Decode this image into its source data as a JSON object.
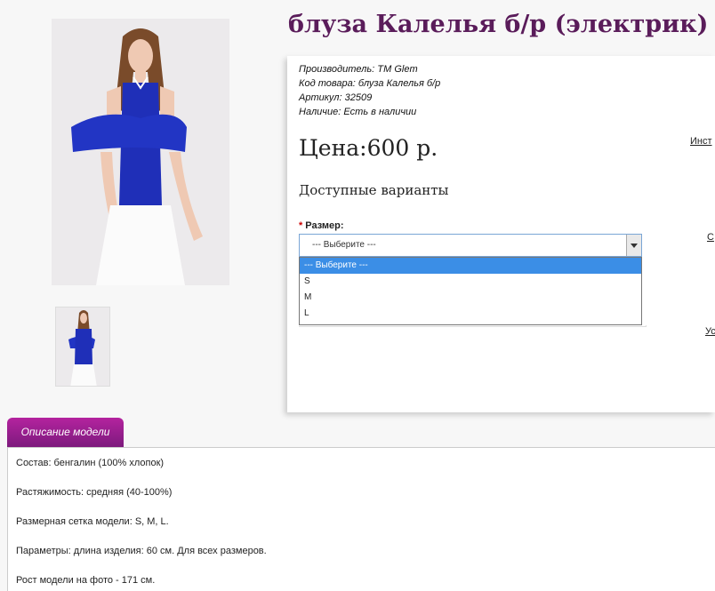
{
  "product": {
    "title": "блуза Калелья б/р (электрик)",
    "manufacturer_label": "Производитель:",
    "manufacturer": "ТМ Glem",
    "code_label": "Код товара:",
    "code": "блуза Калелья б/р",
    "sku_label": "Артикул:",
    "sku": "32509",
    "availability_label": "Наличие:",
    "availability": "Есть в наличии",
    "price": "Цена:600 р."
  },
  "options": {
    "heading": "Доступные варианты",
    "required_mark": "*",
    "size_label": "Размер:",
    "selected": "--- Выберите ---",
    "list": [
      "--- Выберите ---",
      "S",
      "M",
      "L"
    ]
  },
  "side_links": [
    "Инст",
    "С",
    "Ус"
  ],
  "tabs": {
    "description": "Описание модели"
  },
  "description": [
    {
      "label": "Состав:",
      "text": " бенгалин (100% хлопок)"
    },
    {
      "label": "Растяжимость:",
      "text": " средняя (40-100%)"
    },
    {
      "label": "Размерная сетка модели:",
      "text": " S, M, L."
    },
    {
      "label": "Параметры:",
      "text": " длина изделия: 60 см. Для всех размеров."
    },
    {
      "label": "Рост модели на фото - 171 см.",
      "text": ""
    }
  ],
  "colors": {
    "accent": "#7d1a7d",
    "product_blue": "#1f2fb8",
    "select_highlight": "#3b8ee6"
  }
}
